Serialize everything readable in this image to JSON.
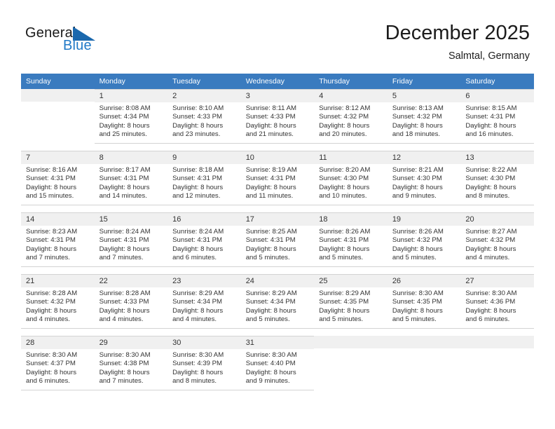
{
  "brand": {
    "name_top": "General",
    "name_bottom": "Blue",
    "accent_color": "#1b68ad",
    "flag_icon": "blue-triangle-flag-icon"
  },
  "header": {
    "month_title": "December 2025",
    "location": "Salmtal, Germany"
  },
  "calendar": {
    "header_bg": "#3a7bbf",
    "header_text_color": "#ffffff",
    "weekdays": [
      "Sunday",
      "Monday",
      "Tuesday",
      "Wednesday",
      "Thursday",
      "Friday",
      "Saturday"
    ],
    "weeks": [
      [
        {
          "day": "",
          "lines": []
        },
        {
          "day": "1",
          "lines": [
            "Sunrise: 8:08 AM",
            "Sunset: 4:34 PM",
            "Daylight: 8 hours",
            "and 25 minutes."
          ]
        },
        {
          "day": "2",
          "lines": [
            "Sunrise: 8:10 AM",
            "Sunset: 4:33 PM",
            "Daylight: 8 hours",
            "and 23 minutes."
          ]
        },
        {
          "day": "3",
          "lines": [
            "Sunrise: 8:11 AM",
            "Sunset: 4:33 PM",
            "Daylight: 8 hours",
            "and 21 minutes."
          ]
        },
        {
          "day": "4",
          "lines": [
            "Sunrise: 8:12 AM",
            "Sunset: 4:32 PM",
            "Daylight: 8 hours",
            "and 20 minutes."
          ]
        },
        {
          "day": "5",
          "lines": [
            "Sunrise: 8:13 AM",
            "Sunset: 4:32 PM",
            "Daylight: 8 hours",
            "and 18 minutes."
          ]
        },
        {
          "day": "6",
          "lines": [
            "Sunrise: 8:15 AM",
            "Sunset: 4:31 PM",
            "Daylight: 8 hours",
            "and 16 minutes."
          ]
        }
      ],
      [
        {
          "day": "7",
          "lines": [
            "Sunrise: 8:16 AM",
            "Sunset: 4:31 PM",
            "Daylight: 8 hours",
            "and 15 minutes."
          ]
        },
        {
          "day": "8",
          "lines": [
            "Sunrise: 8:17 AM",
            "Sunset: 4:31 PM",
            "Daylight: 8 hours",
            "and 14 minutes."
          ]
        },
        {
          "day": "9",
          "lines": [
            "Sunrise: 8:18 AM",
            "Sunset: 4:31 PM",
            "Daylight: 8 hours",
            "and 12 minutes."
          ]
        },
        {
          "day": "10",
          "lines": [
            "Sunrise: 8:19 AM",
            "Sunset: 4:31 PM",
            "Daylight: 8 hours",
            "and 11 minutes."
          ]
        },
        {
          "day": "11",
          "lines": [
            "Sunrise: 8:20 AM",
            "Sunset: 4:30 PM",
            "Daylight: 8 hours",
            "and 10 minutes."
          ]
        },
        {
          "day": "12",
          "lines": [
            "Sunrise: 8:21 AM",
            "Sunset: 4:30 PM",
            "Daylight: 8 hours",
            "and 9 minutes."
          ]
        },
        {
          "day": "13",
          "lines": [
            "Sunrise: 8:22 AM",
            "Sunset: 4:30 PM",
            "Daylight: 8 hours",
            "and 8 minutes."
          ]
        }
      ],
      [
        {
          "day": "14",
          "lines": [
            "Sunrise: 8:23 AM",
            "Sunset: 4:31 PM",
            "Daylight: 8 hours",
            "and 7 minutes."
          ]
        },
        {
          "day": "15",
          "lines": [
            "Sunrise: 8:24 AM",
            "Sunset: 4:31 PM",
            "Daylight: 8 hours",
            "and 7 minutes."
          ]
        },
        {
          "day": "16",
          "lines": [
            "Sunrise: 8:24 AM",
            "Sunset: 4:31 PM",
            "Daylight: 8 hours",
            "and 6 minutes."
          ]
        },
        {
          "day": "17",
          "lines": [
            "Sunrise: 8:25 AM",
            "Sunset: 4:31 PM",
            "Daylight: 8 hours",
            "and 5 minutes."
          ]
        },
        {
          "day": "18",
          "lines": [
            "Sunrise: 8:26 AM",
            "Sunset: 4:31 PM",
            "Daylight: 8 hours",
            "and 5 minutes."
          ]
        },
        {
          "day": "19",
          "lines": [
            "Sunrise: 8:26 AM",
            "Sunset: 4:32 PM",
            "Daylight: 8 hours",
            "and 5 minutes."
          ]
        },
        {
          "day": "20",
          "lines": [
            "Sunrise: 8:27 AM",
            "Sunset: 4:32 PM",
            "Daylight: 8 hours",
            "and 4 minutes."
          ]
        }
      ],
      [
        {
          "day": "21",
          "lines": [
            "Sunrise: 8:28 AM",
            "Sunset: 4:32 PM",
            "Daylight: 8 hours",
            "and 4 minutes."
          ]
        },
        {
          "day": "22",
          "lines": [
            "Sunrise: 8:28 AM",
            "Sunset: 4:33 PM",
            "Daylight: 8 hours",
            "and 4 minutes."
          ]
        },
        {
          "day": "23",
          "lines": [
            "Sunrise: 8:29 AM",
            "Sunset: 4:34 PM",
            "Daylight: 8 hours",
            "and 4 minutes."
          ]
        },
        {
          "day": "24",
          "lines": [
            "Sunrise: 8:29 AM",
            "Sunset: 4:34 PM",
            "Daylight: 8 hours",
            "and 5 minutes."
          ]
        },
        {
          "day": "25",
          "lines": [
            "Sunrise: 8:29 AM",
            "Sunset: 4:35 PM",
            "Daylight: 8 hours",
            "and 5 minutes."
          ]
        },
        {
          "day": "26",
          "lines": [
            "Sunrise: 8:30 AM",
            "Sunset: 4:35 PM",
            "Daylight: 8 hours",
            "and 5 minutes."
          ]
        },
        {
          "day": "27",
          "lines": [
            "Sunrise: 8:30 AM",
            "Sunset: 4:36 PM",
            "Daylight: 8 hours",
            "and 6 minutes."
          ]
        }
      ],
      [
        {
          "day": "28",
          "lines": [
            "Sunrise: 8:30 AM",
            "Sunset: 4:37 PM",
            "Daylight: 8 hours",
            "and 6 minutes."
          ]
        },
        {
          "day": "29",
          "lines": [
            "Sunrise: 8:30 AM",
            "Sunset: 4:38 PM",
            "Daylight: 8 hours",
            "and 7 minutes."
          ]
        },
        {
          "day": "30",
          "lines": [
            "Sunrise: 8:30 AM",
            "Sunset: 4:39 PM",
            "Daylight: 8 hours",
            "and 8 minutes."
          ]
        },
        {
          "day": "31",
          "lines": [
            "Sunrise: 8:30 AM",
            "Sunset: 4:40 PM",
            "Daylight: 8 hours",
            "and 9 minutes."
          ]
        },
        {
          "day": "",
          "lines": []
        },
        {
          "day": "",
          "lines": []
        },
        {
          "day": "",
          "lines": []
        }
      ]
    ]
  }
}
